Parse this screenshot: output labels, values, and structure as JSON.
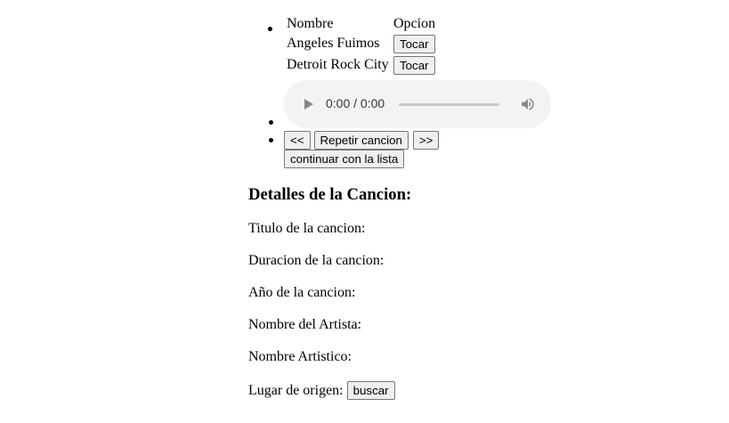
{
  "playlist": {
    "headers": [
      "Nombre",
      "Opcion"
    ],
    "songs": [
      {
        "name": "Angeles Fuimos",
        "action": "Tocar"
      },
      {
        "name": "Detroit Rock City",
        "action": "Tocar"
      }
    ]
  },
  "player": {
    "time": "0:00 / 0:00",
    "progress": 0
  },
  "controls": {
    "prev": "<<",
    "repeat": "Repetir cancion",
    "next": ">>",
    "continue": "continuar con la lista"
  },
  "details": {
    "heading": "Detalles de la Cancion:",
    "title_label": "Titulo de la cancion:",
    "duration_label": "Duracion de la cancion:",
    "year_label": "Año de la cancion:",
    "artist_label": "Nombre del Artista:",
    "artistic_name_label": "Nombre Artistico:",
    "origin_label": "Lugar de origen:",
    "search_button": "buscar"
  },
  "icons": {
    "play": "play-icon",
    "volume": "volume-icon"
  }
}
